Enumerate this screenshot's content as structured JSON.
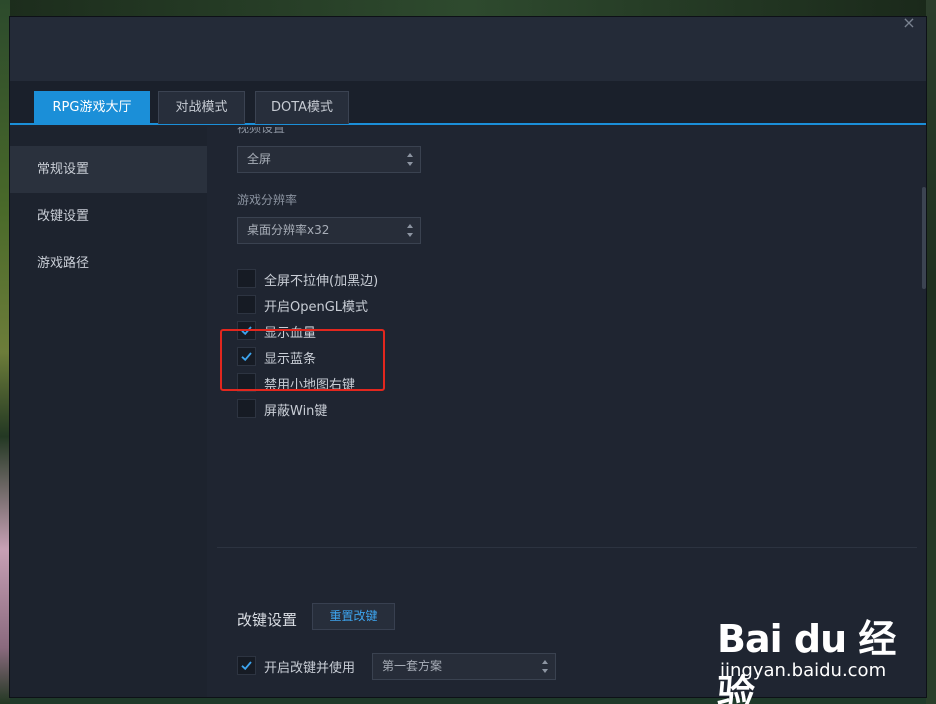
{
  "window": {
    "close_glyph": "×"
  },
  "tabs": [
    {
      "label": "RPG游戏大厅",
      "active": true
    },
    {
      "label": "对战模式",
      "active": false
    },
    {
      "label": "DOTA模式",
      "active": false
    }
  ],
  "sidebar": {
    "items": [
      {
        "label": "常规设置",
        "active": true
      },
      {
        "label": "改键设置",
        "active": false
      },
      {
        "label": "游戏路径",
        "active": false
      }
    ]
  },
  "video": {
    "label": "视频设置",
    "mode_value": "全屏",
    "resolution_label": "游戏分辨率",
    "resolution_value": "桌面分辨率x32"
  },
  "options": [
    {
      "label": "全屏不拉伸(加黑边)",
      "checked": false
    },
    {
      "label": "开启OpenGL模式",
      "checked": false
    },
    {
      "label": "显示血量",
      "checked": true
    },
    {
      "label": "显示蓝条",
      "checked": true
    },
    {
      "label": "禁用小地图右键",
      "checked": false
    },
    {
      "label": "屏蔽Win键",
      "checked": false
    }
  ],
  "keybind": {
    "title": "改键设置",
    "reset_label": "重置改键",
    "enable_label": "开启改键并使用",
    "enable_checked": true,
    "scheme_value": "第一套方案"
  },
  "colors": {
    "accent": "#1b8fd8",
    "highlight": "#e2271e"
  },
  "watermark": {
    "logo": "Bai du 经验",
    "url": "jingyan.baidu.com"
  }
}
